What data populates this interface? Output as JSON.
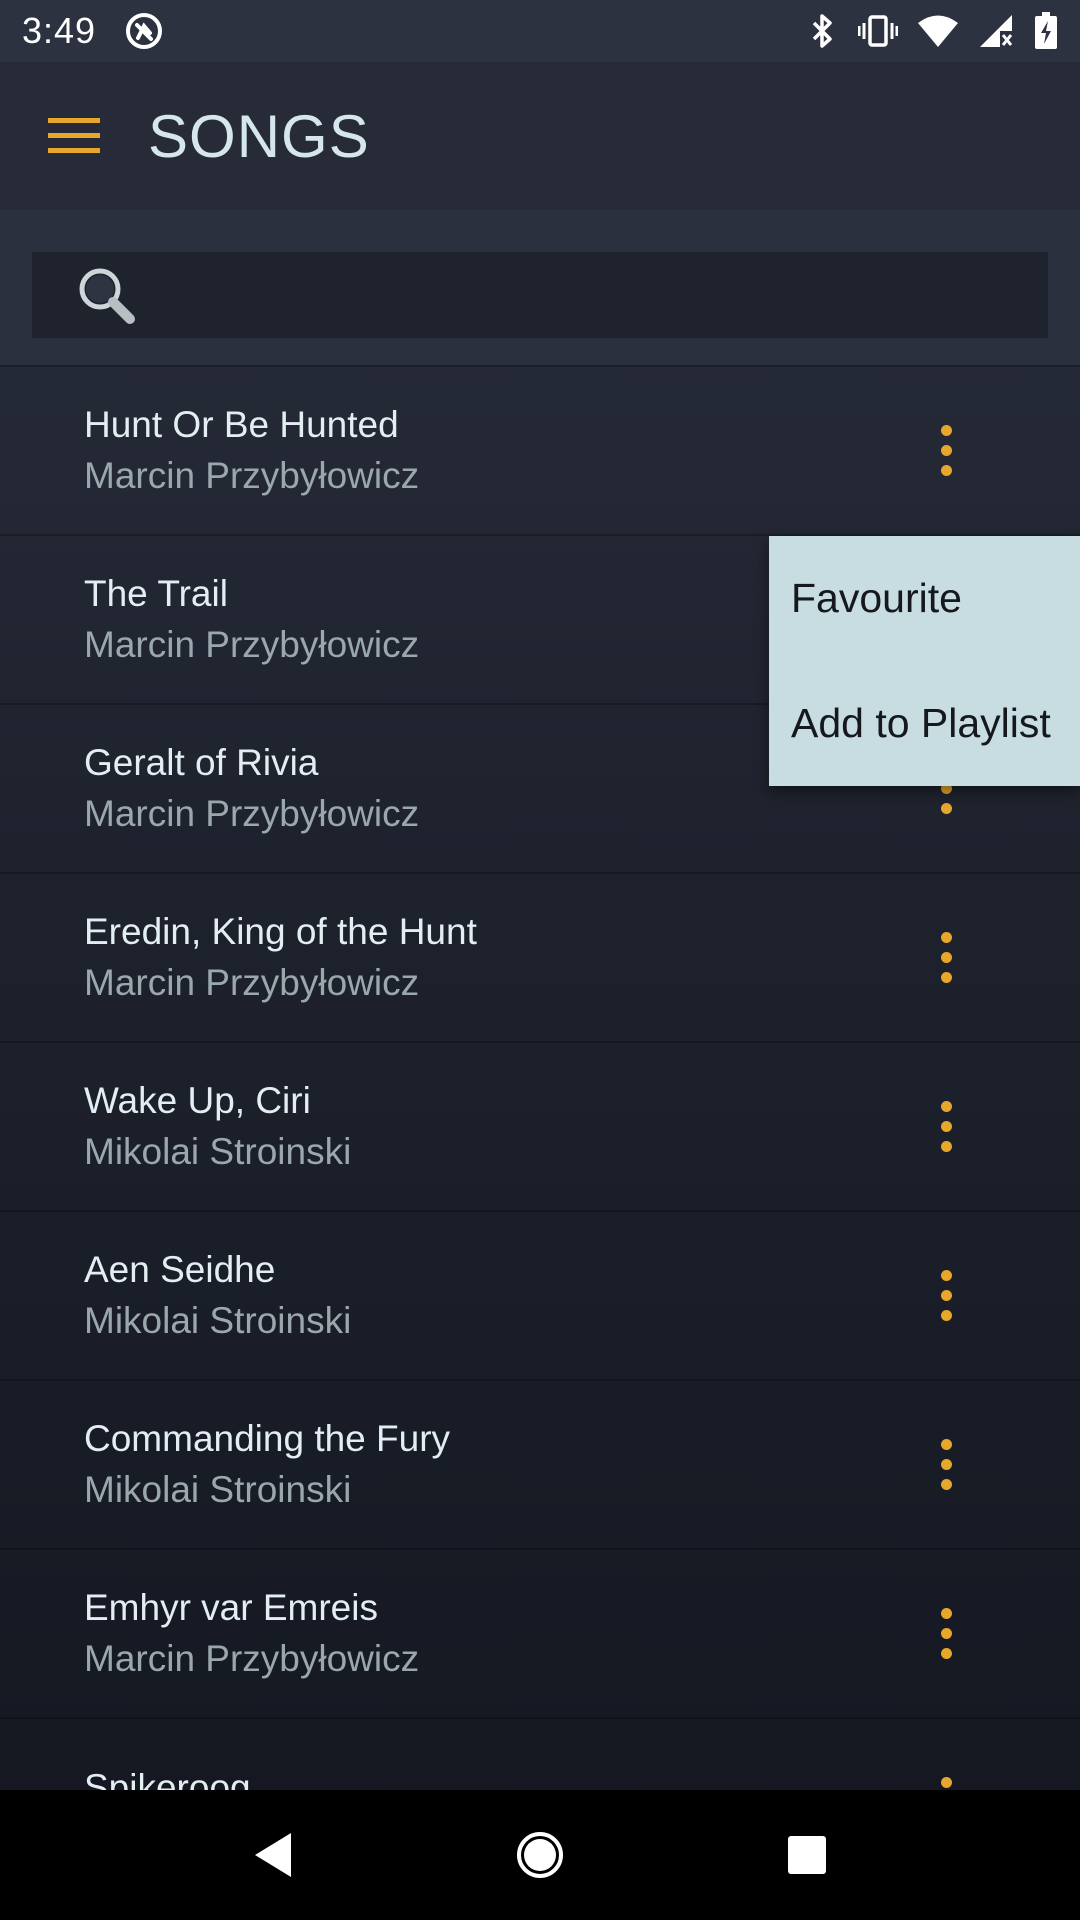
{
  "status_bar": {
    "time": "3:49",
    "icons": [
      "app-notification-icon",
      "bluetooth-icon",
      "vibrate-icon",
      "wifi-icon",
      "cell-signal-icon",
      "battery-charging-icon"
    ]
  },
  "app_bar": {
    "title": "SONGS",
    "menu_icon": "hamburger-menu-icon"
  },
  "search": {
    "placeholder": "",
    "value": "",
    "icon": "search-icon"
  },
  "songs": [
    {
      "title": "Hunt Or Be Hunted",
      "artist": "Marcin Przybyłowicz"
    },
    {
      "title": "The Trail",
      "artist": "Marcin Przybyłowicz"
    },
    {
      "title": "Geralt of Rivia",
      "artist": "Marcin Przybyłowicz"
    },
    {
      "title": "Eredin, King of the Hunt",
      "artist": "Marcin Przybyłowicz"
    },
    {
      "title": "Wake Up, Ciri",
      "artist": "Mikolai Stroinski"
    },
    {
      "title": "Aen Seidhe",
      "artist": "Mikolai Stroinski"
    },
    {
      "title": "Commanding the Fury",
      "artist": "Mikolai Stroinski"
    },
    {
      "title": "Emhyr var Emreis",
      "artist": "Marcin Przybyłowicz"
    },
    {
      "title": "Spikeroog",
      "artist": ""
    }
  ],
  "popup_menu": {
    "items": [
      "Favourite",
      "Add to Playlist"
    ]
  },
  "colors": {
    "accent": "#e6a72b",
    "title_text": "#d5e6ec",
    "popup_bg": "#c8dde1"
  },
  "nav_bar": {
    "buttons": [
      "back-icon",
      "home-icon",
      "recents-icon"
    ]
  }
}
